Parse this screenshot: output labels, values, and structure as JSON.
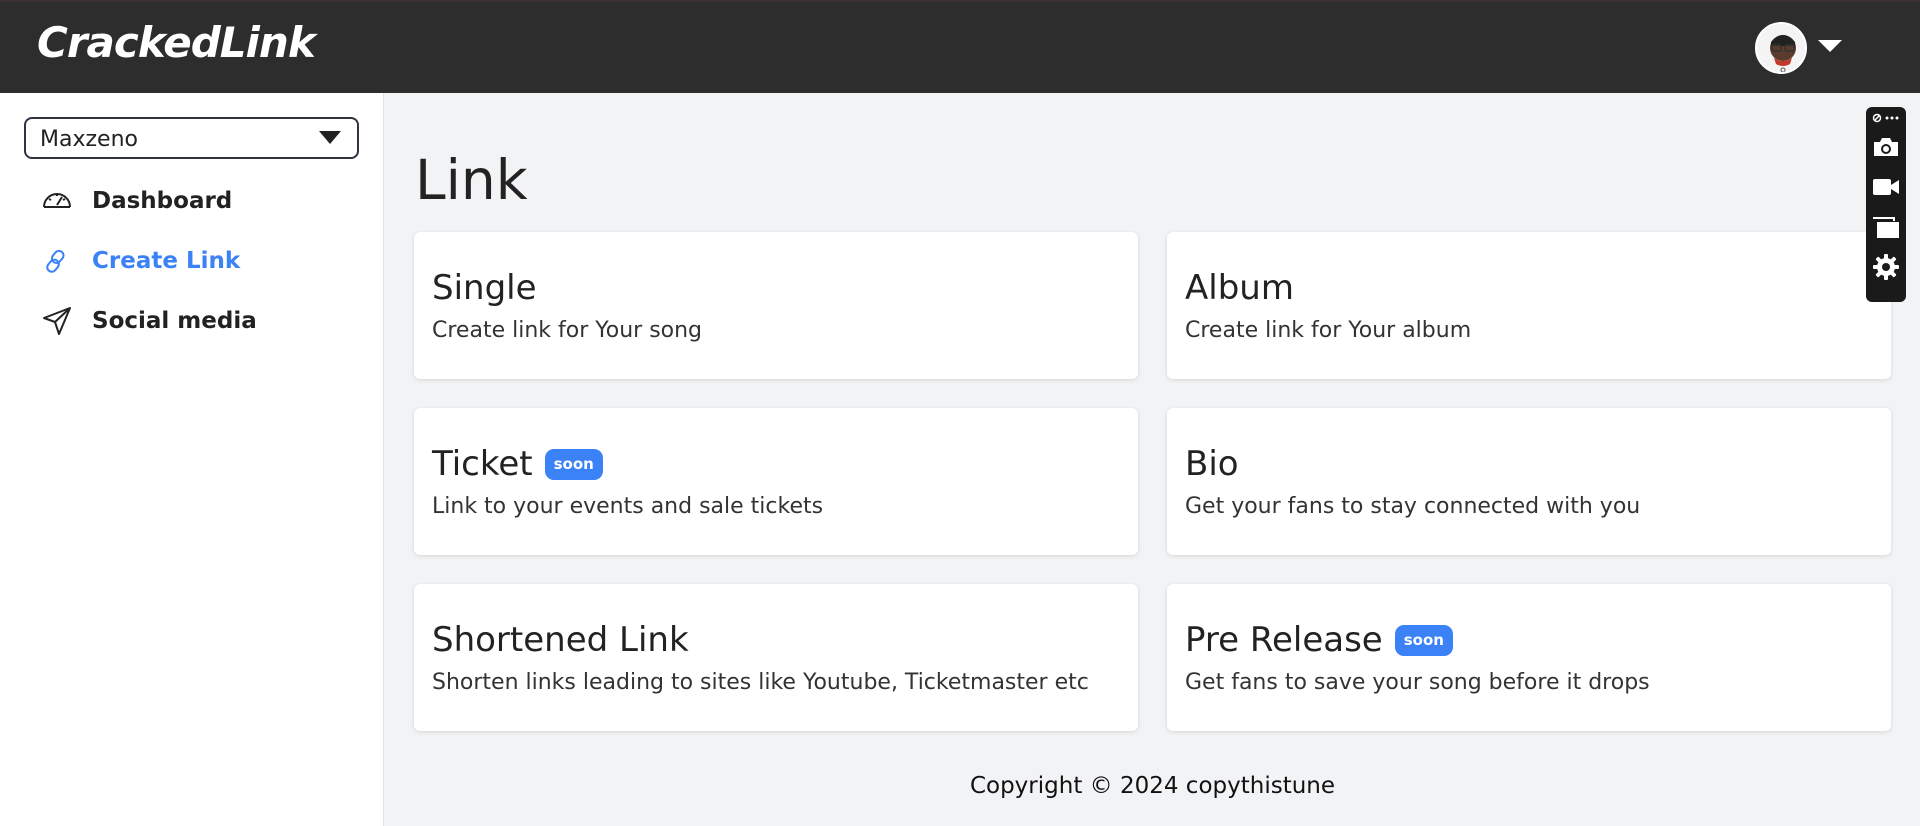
{
  "header": {
    "logo": "CrackedLink",
    "avatar_icon": "user-avatar"
  },
  "sidebar": {
    "account_select": {
      "value": "Maxzeno"
    },
    "items": [
      {
        "label": "Dashboard",
        "icon": "speedometer-icon",
        "active": false
      },
      {
        "label": "Create Link",
        "icon": "link-icon",
        "active": true
      },
      {
        "label": "Social media",
        "icon": "send-icon",
        "active": false
      }
    ]
  },
  "main": {
    "title": "Link",
    "cards": [
      {
        "title": "Single",
        "desc": "Create link for Your song",
        "badge": ""
      },
      {
        "title": "Album",
        "desc": "Create link for Your album",
        "badge": ""
      },
      {
        "title": "Ticket",
        "desc": "Link to your events and sale tickets",
        "badge": "soon"
      },
      {
        "title": "Bio",
        "desc": "Get your fans to stay connected with you",
        "badge": ""
      },
      {
        "title": "Shortened Link",
        "desc": "Shorten links leading to sites like Youtube, Ticketmaster etc",
        "badge": ""
      },
      {
        "title": "Pre Release",
        "desc": "Get fans to save your song before it drops",
        "badge": "soon"
      }
    ],
    "footer": "Copyright © 2024 copythistune"
  },
  "toolbar": {
    "items": [
      "link-more-icon",
      "camera-icon",
      "video-icon",
      "windows-icon",
      "settings-icon"
    ]
  },
  "colors": {
    "accent": "#3b82f6",
    "topbar": "#2d2d2d",
    "background": "#f2f3f5"
  }
}
